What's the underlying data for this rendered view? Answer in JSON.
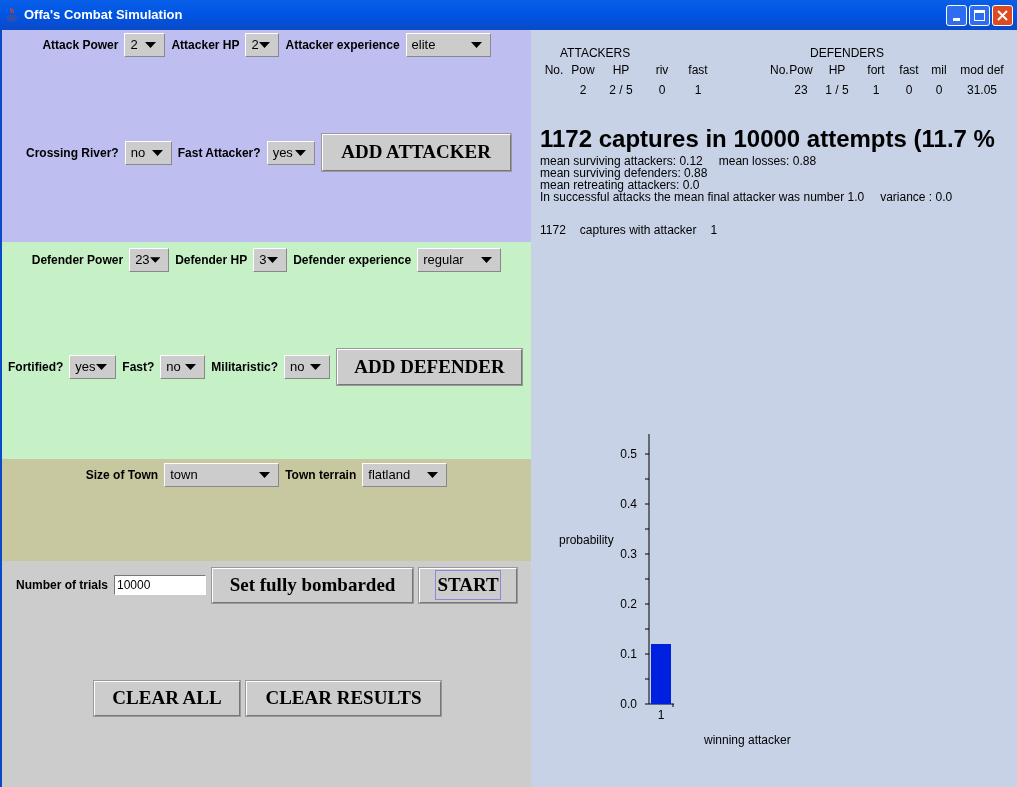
{
  "window": {
    "title": "Offa's Combat Simulation"
  },
  "attacker_panel": {
    "rows": [
      {
        "fields": [
          {
            "label": "Attack Power",
            "value": "2"
          },
          {
            "label": "Attacker HP",
            "value": "2"
          },
          {
            "label": "Attacker experience",
            "value": "elite"
          }
        ]
      },
      {
        "fields": [
          {
            "label": "Crossing River?",
            "value": "no"
          },
          {
            "label": "Fast Attacker?",
            "value": "yes"
          }
        ],
        "button": "ADD ATTACKER"
      }
    ]
  },
  "defender_panel": {
    "rows": [
      {
        "fields": [
          {
            "label": "Defender Power",
            "value": "23"
          },
          {
            "label": "Defender HP",
            "value": "3"
          },
          {
            "label": "Defender experience",
            "value": "regular"
          }
        ]
      },
      {
        "fields": [
          {
            "label": "Fortified?",
            "value": "yes"
          },
          {
            "label": "Fast?",
            "value": "no"
          },
          {
            "label": "Militaristic?",
            "value": "no"
          }
        ],
        "button": "ADD DEFENDER"
      }
    ]
  },
  "town_panel": {
    "fields": [
      {
        "label": "Size of Town",
        "value": "town"
      },
      {
        "label": "Town terrain",
        "value": "flatland"
      }
    ]
  },
  "run_panel": {
    "trials_label": "Number of trials",
    "trials_value": "10000",
    "buttons": [
      {
        "label": "Set fully bombarded",
        "focused": false
      },
      {
        "label": "START",
        "focused": true
      }
    ],
    "clear_buttons": [
      "CLEAR ALL",
      "CLEAR RESULTS"
    ]
  },
  "results": {
    "attackers": {
      "title": "ATTACKERS",
      "columns": [
        "No.",
        "Pow",
        "HP",
        "riv",
        "fast"
      ],
      "rows": [
        {
          "cells": [
            "",
            "2",
            "2 / 5",
            "0",
            "1"
          ]
        }
      ]
    },
    "defenders": {
      "title": "DEFENDERS",
      "columns": [
        "No.",
        "Pow",
        "HP",
        "fort",
        "fast",
        "mil",
        "mod def"
      ],
      "rows": [
        {
          "cells": [
            "",
            "23",
            "1 / 5",
            "1",
            "0",
            "0",
            "31.05"
          ]
        }
      ]
    },
    "headline": "1172 captures in 10000 attempts (11.7 %",
    "stats": [
      [
        "mean surviving attackers: 0.12",
        "mean losses: 0.88"
      ],
      [
        "mean surviving defenders: 0.88"
      ],
      [
        "mean retreating attackers: 0.0"
      ],
      [
        "In successful attacks the mean final attacker was number 1.0",
        "variance : 0.0"
      ]
    ],
    "distribution": [
      {
        "count": "1172",
        "label": "captures with attacker",
        "attacker": "1"
      }
    ],
    "chart_data": {
      "type": "bar",
      "xlabel": "winning attacker",
      "ylabel": "probability",
      "categories": [
        "1"
      ],
      "series": [
        {
          "color": "#0020e0",
          "values": [
            0.12
          ]
        }
      ],
      "ylim": [
        0,
        0.54
      ],
      "yticks": [
        {
          "value": 0,
          "label": "0.0"
        },
        {
          "value": 0.1,
          "label": "0.1"
        },
        {
          "value": 0.2,
          "label": "0.2"
        },
        {
          "value": 0.3,
          "label": "0.3"
        },
        {
          "value": 0.4,
          "label": "0.4"
        },
        {
          "value": 0.5,
          "label": "0.5"
        }
      ]
    }
  }
}
